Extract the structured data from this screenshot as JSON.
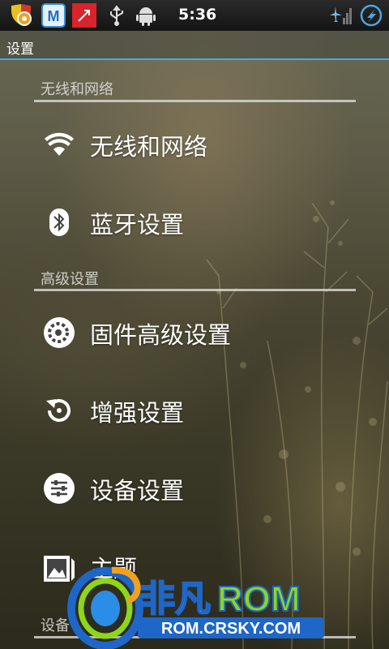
{
  "status_bar": {
    "time": "5:36",
    "left_icons": [
      "shield-gear-icon",
      "m-app-icon",
      "red-arrow-app-icon",
      "usb-icon",
      "android-debug-icon"
    ],
    "right_icons": [
      "airplane-signal-icon",
      "sync-icon"
    ]
  },
  "title_bar": {
    "title": "设置"
  },
  "sections": [
    {
      "header": "无线和网络",
      "items": [
        {
          "label": "无线和网络",
          "icon": "wifi-icon"
        },
        {
          "label": "蓝牙设置",
          "icon": "bluetooth-icon"
        }
      ]
    },
    {
      "header": "高级设置",
      "items": [
        {
          "label": "固件高级设置",
          "icon": "firmware-gear-icon"
        },
        {
          "label": "增强设置",
          "icon": "enhance-icon"
        },
        {
          "label": "设备设置",
          "icon": "device-settings-icon"
        },
        {
          "label": "主题",
          "icon": "theme-icon"
        }
      ]
    },
    {
      "header": "设备"
    }
  ],
  "watermark": {
    "brand_cn": "非凡",
    "brand_en": "ROM",
    "url": "ROM.CRSKY.COM"
  },
  "colors": {
    "accent": "#33b5e5",
    "statusbar": "#1a1a1a",
    "watermark_green": "#8ed61a",
    "watermark_blue": "#1e66c8"
  }
}
